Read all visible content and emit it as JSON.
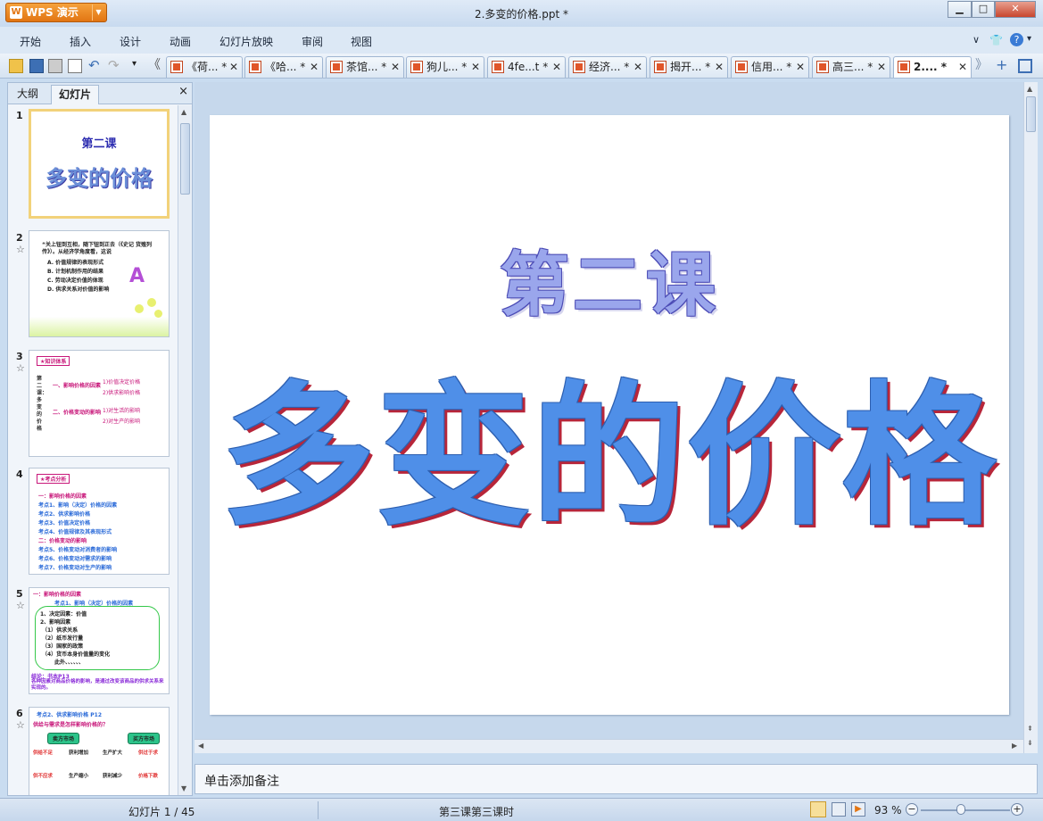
{
  "app": {
    "name": "WPS 演示",
    "window_title": "2.多变的价格.ppt *"
  },
  "menu": [
    "开始",
    "插入",
    "设计",
    "动画",
    "幻灯片放映",
    "审阅",
    "视图"
  ],
  "tabs": [
    "《荷... *",
    "《哈... *",
    "茶馆... *",
    "狗儿... *",
    "4fe...t *",
    "经济... *",
    "揭开... *",
    "信用... *",
    "高三... *",
    "2.... *"
  ],
  "left_panel": {
    "tab_outline": "大纲",
    "tab_slides": "幻灯片",
    "close": "×"
  },
  "thumbnails": [
    {
      "num": "1",
      "title": "第二课",
      "subtitle": "多变的价格"
    },
    {
      "num": "2",
      "lines": [
        "“关上钮到互相，随下钮到正去（《史记 货殖列传》）。从经济学角度看，这说",
        "A. 价值规律的表现形式",
        "B. 计划机制作用的结果",
        "C. 劳动决定价值的体现",
        "D. 供求关系对价值的影响"
      ],
      "letter": "A"
    },
    {
      "num": "3",
      "badge": "★知识体系",
      "side": "第二课：多变的价格",
      "items": [
        "一、影响价格的因素",
        "二、价格变动的影响"
      ],
      "sub1": [
        "1)价值决定价格",
        "2)供求影响价格"
      ],
      "sub2": [
        "1)对生活的影响",
        "2)对生产的影响"
      ]
    },
    {
      "num": "4",
      "badge": "★考点分析",
      "lines": [
        "一：影响价格的因素",
        "考点1、影响（决定）价格的因素",
        "考点2、供求影响价格",
        "考点3、价值决定价格",
        "考点4、价值规律及其表现形式",
        "二：价格变动的影响",
        "考点5、价格变动对消费者的影响",
        "考点6、价格变动对需求的影响",
        "考点7、价格变动对生产的影响"
      ]
    },
    {
      "num": "5",
      "head": "一：影响价格的因素",
      "sub": "考点1、影响（决定）价格的因素",
      "lines": [
        "1、决定因素：价值",
        "2、影响因素",
        "（1）供求关系",
        "（2）纸币发行量",
        "（3）国家的政策",
        "（4）货币本身价值量的变化",
        "此外、、、、、、"
      ],
      "summary": "结论：书本P13",
      "summary2": "各种因素对商品价格的影响，是通过改变该商品的供求关系来实现的。"
    },
    {
      "num": "6",
      "head": "考点2、供求影响价格 P12",
      "question": "供给与需求是怎样影响价格的？",
      "b1": "卖方市场",
      "b2": "买方市场",
      "row1": [
        "供给不足",
        "获利增加",
        "生产扩大",
        "供过于求"
      ],
      "row2": [
        "供不应求",
        "生产缩小",
        "获利减少",
        "价格下跌"
      ]
    }
  ],
  "slide": {
    "title": "第二课",
    "subtitle": "多变的价格"
  },
  "notes_placeholder": "单击添加备注",
  "status": {
    "slide_info": "幻灯片 1 / 45",
    "template": "第三课第三课时",
    "zoom": "93 %"
  }
}
